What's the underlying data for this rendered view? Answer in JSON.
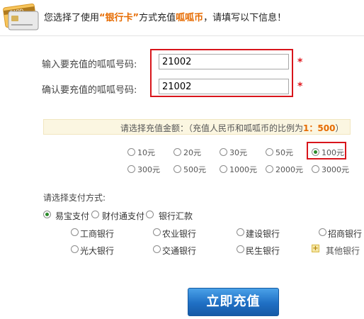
{
  "header": {
    "icon": "card-icon",
    "text_prefix": "您选择了使用",
    "method_name": "“银行卡”",
    "text_mid": "方式充值",
    "currency": "呱呱币",
    "text_suffix": "，请填写以下信息！"
  },
  "account": {
    "label_enter": "输入要充值的呱呱号码:",
    "label_confirm": "确认要充值的呱呱号码:",
    "value_enter": "21002",
    "value_confirm": "21002",
    "required_mark": "*"
  },
  "amount": {
    "prompt": "请选择充值金额：（充值人民币和呱呱币的比例为",
    "ratio": "1：500",
    "prompt_end": "）",
    "options": [
      "10元",
      "20元",
      "30元",
      "50元",
      "100元",
      "300元",
      "500元",
      "1000元",
      "2000元",
      "3000元"
    ],
    "selected": "100元"
  },
  "payment": {
    "title": "请选择支付方式:",
    "methods": [
      "易宝支付",
      "财付通支付",
      "银行汇款"
    ],
    "selected_method": "易宝支付",
    "banks": [
      "工商银行",
      "农业银行",
      "建设银行",
      "招商银行",
      "光大银行",
      "交通银行",
      "民生银行"
    ],
    "other_banks": "其他银行"
  },
  "submit_label": "立即充值"
}
